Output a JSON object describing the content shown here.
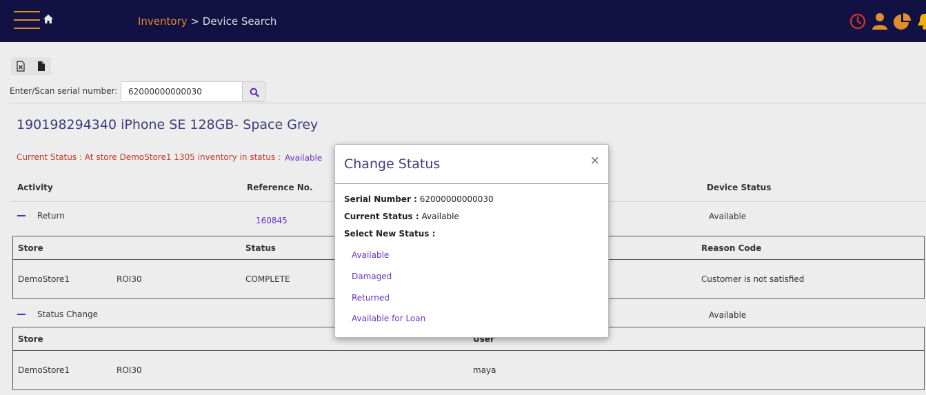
{
  "header": {
    "breadcrumb_root": "Inventory",
    "breadcrumb_sep": " > ",
    "breadcrumb_current": "Device Search",
    "colors": {
      "bar": "#111143",
      "accent": "#e08e2c",
      "alert": "#d0322c",
      "bell": "#f0b400"
    },
    "icons": [
      "menu-icon",
      "home-icon",
      "clock-icon",
      "user-icon",
      "pie-chart-icon",
      "bell-icon"
    ]
  },
  "toolbar": {
    "icons": [
      "excel-export-icon",
      "document-export-icon"
    ]
  },
  "search": {
    "label": "Enter/Scan serial number:",
    "value": "62000000000030"
  },
  "device": {
    "title": "190198294340 iPhone SE 128GB- Space Grey",
    "status_text": "Current Status : At store DemoStore1 1305 inventory in status :",
    "status_value": "Available"
  },
  "activity_table": {
    "headers": {
      "activity": "Activity",
      "reference": "Reference No.",
      "device_status": "Device Status"
    },
    "rows": [
      {
        "activity": "Return",
        "reference": "160845",
        "device_status": "Available",
        "detail": {
          "headers": {
            "store": "Store",
            "status": "Status",
            "reason": "Reason Code"
          },
          "row": {
            "store": "DemoStore1",
            "code": "ROI30",
            "status": "COMPLETE",
            "reason": "Customer is not satisfied"
          }
        }
      },
      {
        "activity": "Status Change",
        "device_status": "Available",
        "detail": {
          "headers": {
            "store": "Store",
            "user": "User"
          },
          "row": {
            "store": "DemoStore1",
            "code": "ROI30",
            "user": "maya"
          }
        }
      }
    ]
  },
  "modal": {
    "title": "Change Status",
    "close": "×",
    "serial_label": "Serial Number :",
    "serial_value": "62000000000030",
    "current_label": "Current Status :",
    "current_value": "Available",
    "select_label": "Select New Status :",
    "options": [
      "Available",
      "Damaged",
      "Returned",
      "Available for Loan"
    ]
  }
}
